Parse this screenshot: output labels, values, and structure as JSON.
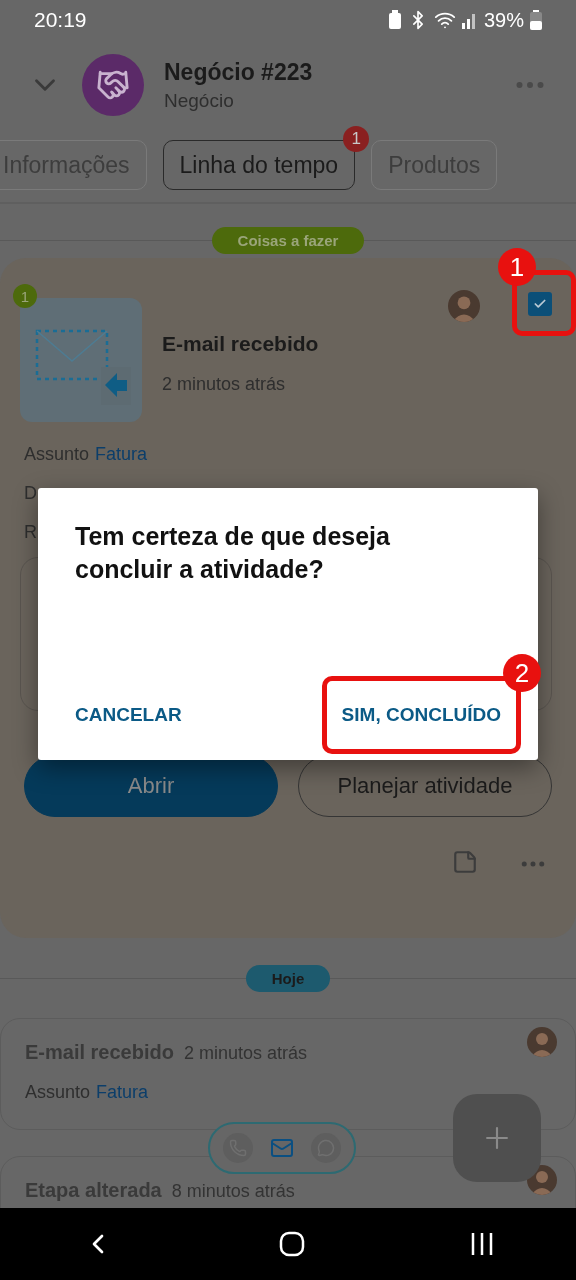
{
  "status_bar": {
    "time": "20:19",
    "battery": "39%"
  },
  "header": {
    "title": "Negócio #223",
    "subtitle": "Negócio"
  },
  "tabs": [
    {
      "label": "Informações",
      "selected": false
    },
    {
      "label": "Linha do tempo",
      "selected": true,
      "badge": "1"
    },
    {
      "label": "Produtos",
      "selected": false
    }
  ],
  "todo_label": "Coisas a fazer",
  "todo_card": {
    "badge": "1",
    "title": "E-mail recebido",
    "time": "2 minutos atrás",
    "checked": true,
    "checkbox_annotation": "1",
    "fields": [
      {
        "label": "Assunto",
        "value": "Fatura"
      },
      {
        "label": "D"
      },
      {
        "label": "R"
      }
    ],
    "buttons": [
      {
        "label": "Abrir",
        "kind": "primary"
      },
      {
        "label": "Planejar atividade",
        "kind": "outline"
      }
    ]
  },
  "today_label": "Hoje",
  "history": [
    {
      "title": "E-mail recebido",
      "time": "2 minutos atrás",
      "fields": [
        {
          "label": "Assunto",
          "value": "Fatura"
        }
      ]
    },
    {
      "title": "Etapa alterada",
      "time": "8 minutos atrás"
    }
  ],
  "channel_switcher": [
    {
      "kind": "phone",
      "selected": false
    },
    {
      "kind": "mail",
      "selected": true
    },
    {
      "kind": "chat",
      "selected": false
    }
  ],
  "dialog": {
    "message": "Tem certeza de que deseja concluir a atividade?",
    "buttons": [
      {
        "label": "CANCELAR"
      },
      {
        "label": "SIM, CONCLUÍDO",
        "annotation": "2"
      }
    ]
  }
}
